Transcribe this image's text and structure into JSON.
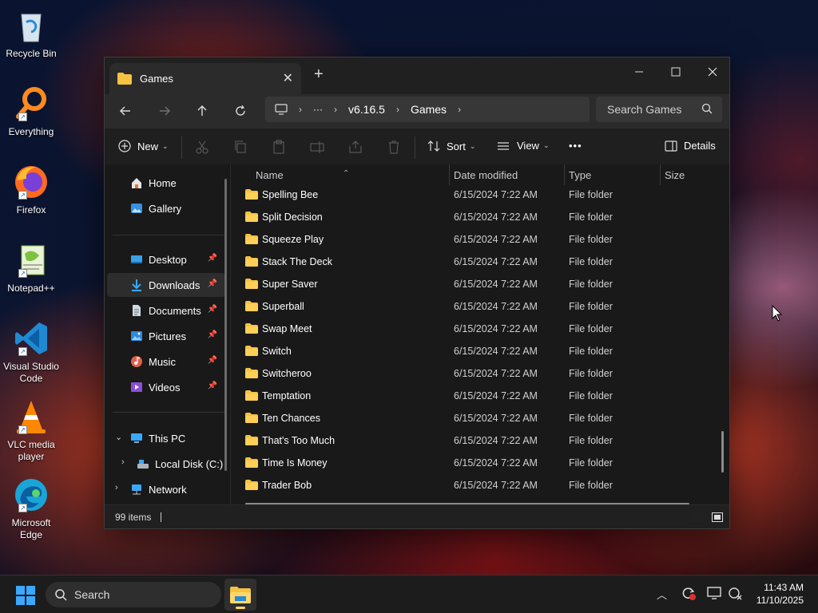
{
  "desktop": {
    "icons": [
      {
        "label": "Recycle Bin",
        "icon": "recycle-bin-icon"
      },
      {
        "label": "Everything",
        "icon": "everything-icon"
      },
      {
        "label": "Firefox",
        "icon": "firefox-icon"
      },
      {
        "label": "Notepad++",
        "icon": "notepadpp-icon"
      },
      {
        "label": "Visual Studio Code",
        "icon": "vscode-icon"
      },
      {
        "label": "VLC media player",
        "icon": "vlc-icon"
      },
      {
        "label": "Microsoft Edge",
        "icon": "edge-icon"
      }
    ]
  },
  "window": {
    "tab_title": "Games",
    "breadcrumb": {
      "more": "···",
      "items": [
        "v6.16.5",
        "Games"
      ]
    },
    "search_placeholder": "Search Games",
    "toolbar": {
      "new_label": "New",
      "sort_label": "Sort",
      "view_label": "View",
      "more_label": "•••",
      "details_label": "Details"
    },
    "sidebar": {
      "top": [
        {
          "label": "Home",
          "icon": "home-icon"
        },
        {
          "label": "Gallery",
          "icon": "gallery-icon"
        }
      ],
      "pinned": [
        {
          "label": "Desktop",
          "icon": "desktop-folder-icon"
        },
        {
          "label": "Downloads",
          "icon": "downloads-icon",
          "selected": true
        },
        {
          "label": "Documents",
          "icon": "documents-icon"
        },
        {
          "label": "Pictures",
          "icon": "pictures-icon"
        },
        {
          "label": "Music",
          "icon": "music-icon"
        },
        {
          "label": "Videos",
          "icon": "videos-icon"
        }
      ],
      "this_pc": "This PC",
      "local_disk": "Local Disk (C:)",
      "network": "Network"
    },
    "columns": {
      "name": "Name",
      "date": "Date modified",
      "type": "Type",
      "size": "Size"
    },
    "files": [
      {
        "name": "Spelling Bee",
        "date": "6/15/2024 7:22 AM",
        "type": "File folder"
      },
      {
        "name": "Split Decision",
        "date": "6/15/2024 7:22 AM",
        "type": "File folder"
      },
      {
        "name": "Squeeze Play",
        "date": "6/15/2024 7:22 AM",
        "type": "File folder"
      },
      {
        "name": "Stack The Deck",
        "date": "6/15/2024 7:22 AM",
        "type": "File folder"
      },
      {
        "name": "Super Saver",
        "date": "6/15/2024 7:22 AM",
        "type": "File folder"
      },
      {
        "name": "Superball",
        "date": "6/15/2024 7:22 AM",
        "type": "File folder"
      },
      {
        "name": "Swap Meet",
        "date": "6/15/2024 7:22 AM",
        "type": "File folder"
      },
      {
        "name": "Switch",
        "date": "6/15/2024 7:22 AM",
        "type": "File folder"
      },
      {
        "name": "Switcheroo",
        "date": "6/15/2024 7:22 AM",
        "type": "File folder"
      },
      {
        "name": "Temptation",
        "date": "6/15/2024 7:22 AM",
        "type": "File folder"
      },
      {
        "name": "Ten Chances",
        "date": "6/15/2024 7:22 AM",
        "type": "File folder"
      },
      {
        "name": "That's Too Much",
        "date": "6/15/2024 7:22 AM",
        "type": "File folder"
      },
      {
        "name": "Time Is Money",
        "date": "6/15/2024 7:22 AM",
        "type": "File folder"
      },
      {
        "name": "Trader Bob",
        "date": "6/15/2024 7:22 AM",
        "type": "File folder"
      }
    ],
    "status": "99 items"
  },
  "taskbar": {
    "search_label": "Search",
    "time": "11:43 AM",
    "date": "11/10/2025"
  },
  "colors": {
    "accent": "#3aa8ff",
    "folder": "#f5c242",
    "window_bg": "#191919"
  }
}
